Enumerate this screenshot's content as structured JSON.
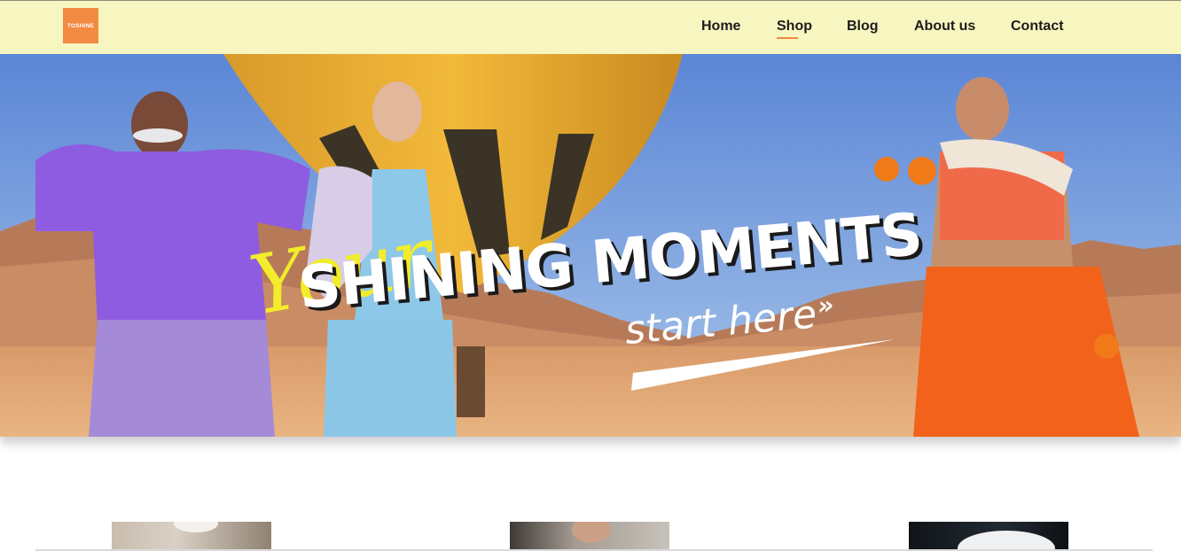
{
  "brand": {
    "logo_text": "TOSHINE",
    "logo_color": "#f38a43"
  },
  "header": {
    "background": "#f8f6c0"
  },
  "nav": {
    "items": [
      {
        "label": "Home",
        "active": false
      },
      {
        "label": "Shop",
        "active": true
      },
      {
        "label": "Blog",
        "active": false
      },
      {
        "label": "About us",
        "active": false
      },
      {
        "label": "Contact",
        "active": false
      }
    ],
    "active_underline_color": "#f08a3c"
  },
  "hero": {
    "script_text": "Your",
    "title": "SHINING MOMENTS",
    "cta": "start here",
    "cta_arrow": "»"
  },
  "products": {
    "count_visible": 3
  }
}
